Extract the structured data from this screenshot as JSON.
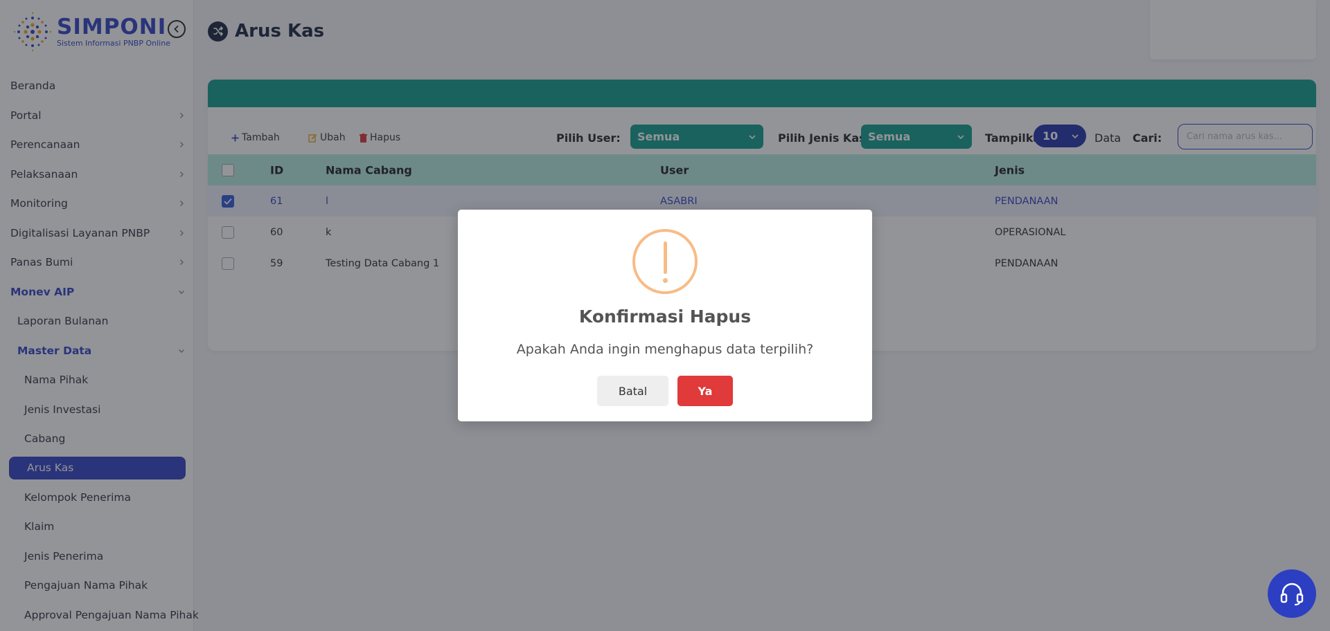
{
  "brand": {
    "name": "SIMPONI",
    "tagline": "Sistem Informasi PNBP Online",
    "color": "#2c3fc2"
  },
  "sidebar": {
    "items": [
      {
        "label": "Beranda",
        "level": 0,
        "has_children": false
      },
      {
        "label": "Portal",
        "level": 0,
        "has_children": true
      },
      {
        "label": "Perencanaan",
        "level": 0,
        "has_children": true
      },
      {
        "label": "Pelaksanaan",
        "level": 0,
        "has_children": true
      },
      {
        "label": "Monitoring",
        "level": 0,
        "has_children": true
      },
      {
        "label": "Digitalisasi Layanan PNBP",
        "level": 0,
        "has_children": true
      },
      {
        "label": "Panas Bumi",
        "level": 0,
        "has_children": true
      },
      {
        "label": "Monev AIP",
        "level": 0,
        "expanded": true
      },
      {
        "label": "Laporan Bulanan",
        "level": 1
      },
      {
        "label": "Master Data",
        "level": 1,
        "expanded": true
      },
      {
        "label": "Nama Pihak",
        "level": 2
      },
      {
        "label": "Jenis Investasi",
        "level": 2
      },
      {
        "label": "Cabang",
        "level": 2
      },
      {
        "label": "Arus Kas",
        "level": 2,
        "active": true
      },
      {
        "label": "Kelompok Penerima",
        "level": 2
      },
      {
        "label": "Klaim",
        "level": 2
      },
      {
        "label": "Jenis Penerima",
        "level": 2
      },
      {
        "label": "Pengajuan Nama Pihak",
        "level": 2
      },
      {
        "label": "Approval Pengajuan Nama Pihak",
        "level": 2
      }
    ]
  },
  "page": {
    "title": "Arus Kas"
  },
  "toolbar": {
    "add_label": "Tambah",
    "edit_label": "Ubah",
    "delete_label": "Hapus",
    "user_filter_label": "Pilih User:",
    "user_filter_value": "Semua",
    "type_filter_label": "Pilih Jenis Kas:",
    "type_filter_value": "Semua",
    "show_label": "Tampilkan",
    "show_value": "10",
    "data_label": "Data",
    "search_label": "Cari:",
    "search_placeholder": "Cari nama arus kas...",
    "search_value": ""
  },
  "table": {
    "columns": [
      "ID",
      "Nama Cabang",
      "User",
      "Jenis"
    ],
    "rows": [
      {
        "id": "61",
        "nama_cabang": "l",
        "user": "ASABRI",
        "jenis": "PENDANAAN",
        "checked": true
      },
      {
        "id": "60",
        "nama_cabang": "k",
        "user": "",
        "jenis": "OPERASIONAL",
        "checked": false
      },
      {
        "id": "59",
        "nama_cabang": "Testing Data Cabang 1",
        "user": "",
        "jenis": "PENDANAAN",
        "checked": false
      }
    ]
  },
  "modal": {
    "icon": "warning-icon",
    "title": "Konfirmasi Hapus",
    "message": "Apakah Anda ingin menghapus data terpilih?",
    "cancel_label": "Batal",
    "confirm_label": "Ya"
  },
  "colors": {
    "accent": "#2c3fc2",
    "teal": "#0d9a8a",
    "danger": "#e03a3a",
    "warning": "#f8bb86"
  }
}
